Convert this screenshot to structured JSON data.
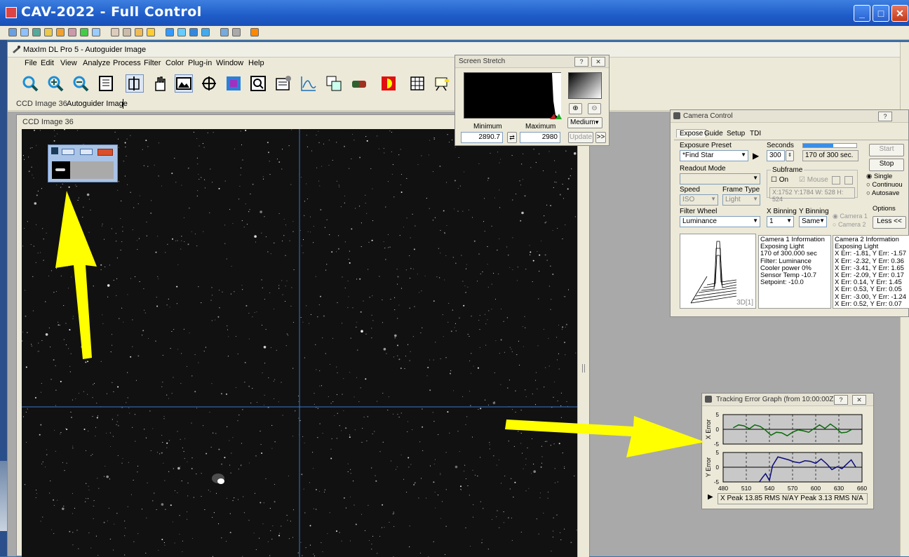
{
  "outer_window": {
    "title": "CAV-2022 - Full Control"
  },
  "maxim": {
    "title": "MaxIm DL Pro 5 - Autoguider Image",
    "menu": [
      "File",
      "Edit",
      "View",
      "Analyze",
      "Process",
      "Filter",
      "Color",
      "Plug-in",
      "Window",
      "Help"
    ],
    "tabs": [
      "CCD Image 36",
      "Autoguider Image"
    ]
  },
  "ccd_window": {
    "caption": "CCD Image 36"
  },
  "screen_stretch": {
    "title": "Screen Stretch",
    "minimum_label": "Minimum",
    "maximum_label": "Maximum",
    "minimum_value": "2890.7",
    "maximum_value": "2980",
    "preset": "Medium",
    "update_label": "Update",
    "more_label": ">>",
    "help_label": "?",
    "close_label": "✕"
  },
  "camera_control": {
    "title": "Camera Control",
    "tabs": [
      "Expose",
      "Guide",
      "Setup",
      "TDI"
    ],
    "exposure_preset_label": "Exposure Preset",
    "exposure_preset_value": "*Find Star",
    "seconds_label": "Seconds",
    "seconds_value": "300",
    "progress_text": "170 of 300 sec.",
    "progress_fraction": 0.567,
    "readout_mode_label": "Readout Mode",
    "subframe_label": "Subframe",
    "subframe_on_label": "On",
    "subframe_mouse_label": "Mouse",
    "subframe_coords": "X:1752 Y:1784 W: 528 H: 524",
    "speed_label": "Speed",
    "speed_value": "ISO",
    "frame_type_label": "Frame Type",
    "frame_type_value": "Light",
    "filter_wheel_label": "Filter Wheel",
    "filter_wheel_value": "Luminance",
    "x_binning_label": "X Binning",
    "x_binning_value": "1",
    "y_binning_label": "Y Binning",
    "y_binning_value": "Same",
    "camera1_label": "Camera 1",
    "camera2_label": "Camera 2",
    "start_label": "Start",
    "stop_label": "Stop",
    "single_label": "Single",
    "continuous_label": "Continuou",
    "autosave_label": "Autosave",
    "options_label": "Options",
    "less_label": "Less <<",
    "plot3d_label": "3D[1]",
    "camera1_info": [
      "Camera 1 Information",
      "Exposing Light",
      "170 of 300.000 sec",
      "Filter: Luminance",
      "Cooler power 0%",
      "Sensor Temp -10.7",
      "Setpoint: -10.0"
    ],
    "camera2_info": [
      "Camera 2 Information",
      "Exposing Light",
      "X Err: -1.81, Y Err: -1.57",
      "X Err: -2.32, Y Err: 0.36",
      "X Err: -3.41, Y Err: 1.65",
      "X Err: -2.09, Y Err: 0.17",
      "X Err: 0.14, Y Err: 1.45",
      "X Err: 0.53, Y Err: 0.05",
      "X Err: -3.00, Y Err: -1.24",
      "X Err: 0.52, Y Err: 0.07"
    ]
  },
  "tracking_graph": {
    "title": "Tracking Error Graph (from 10:00:00Z)",
    "x_axis_label": "X Error",
    "y_axis_label": "Y Error",
    "x_ticks": [
      "480",
      "510",
      "540",
      "570",
      "600",
      "630",
      "660"
    ],
    "y_ticks": [
      "5",
      "0",
      "-5"
    ],
    "status_x": "X Peak 13.85 RMS N/A",
    "status_y": "Y Peak 3.13  RMS N/A"
  },
  "chart_data": {
    "type": "line",
    "x_range": [
      480,
      660
    ],
    "y_range": [
      -5,
      5
    ],
    "series": [
      {
        "name": "X Error",
        "x": [
          493,
          500,
          507,
          514,
          521,
          528,
          535,
          542,
          549,
          556,
          563,
          570,
          577,
          584,
          591,
          598,
          605,
          612,
          619,
          626,
          633,
          640,
          647
        ],
        "y": [
          0.5,
          1.5,
          1.2,
          0.2,
          1.5,
          1.0,
          -0.3,
          -2.0,
          -1.0,
          -1.2,
          -2.2,
          -1.0,
          -0.2,
          -0.5,
          -1.0,
          0.3,
          1.5,
          0.3,
          1.8,
          0.5,
          -1.2,
          -1.0,
          0.0
        ]
      },
      {
        "name": "Y Error",
        "x": [
          527,
          531,
          535,
          540,
          544,
          551,
          558,
          565,
          572,
          579,
          586,
          593,
          600,
          607,
          614,
          621,
          628,
          634,
          640,
          646,
          652
        ],
        "y": [
          -5.0,
          -3.5,
          -2.2,
          -4.5,
          0.5,
          3.5,
          3.0,
          2.5,
          1.8,
          1.5,
          2.2,
          2.0,
          1.3,
          2.8,
          1.2,
          -0.8,
          0.2,
          -0.5,
          1.0,
          2.5,
          0.0
        ]
      }
    ]
  }
}
